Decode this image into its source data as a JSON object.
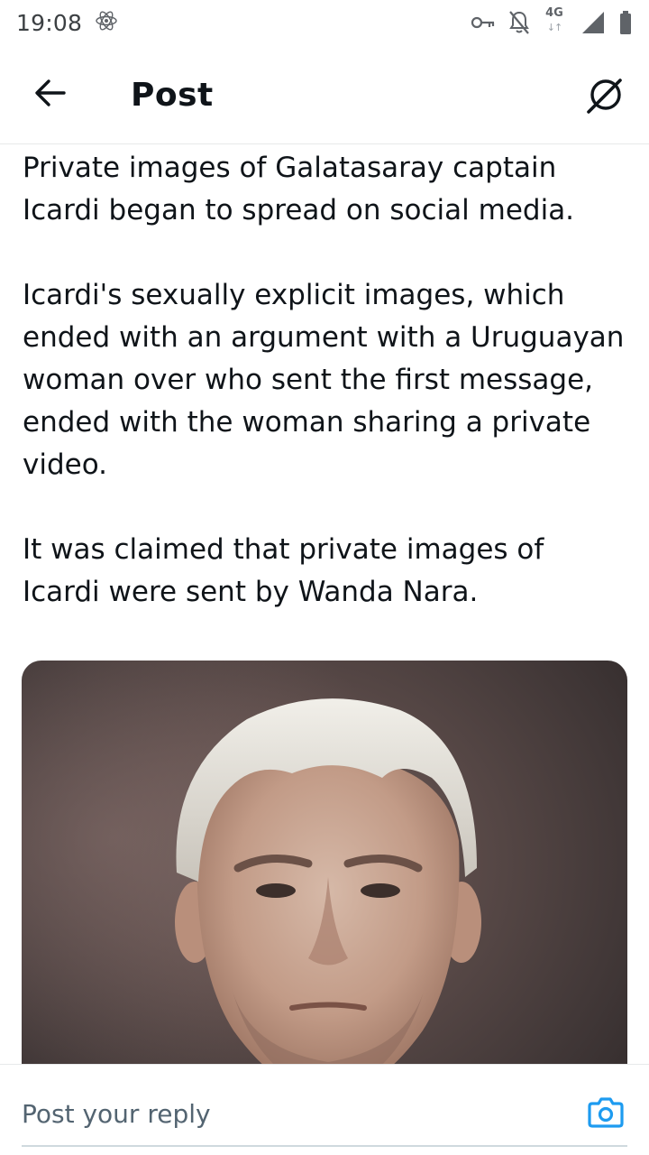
{
  "status_bar": {
    "time": "19:08",
    "icons": [
      "atom-icon",
      "vpn-key-icon",
      "notifications-off-icon",
      "network-4g-icon",
      "signal-icon",
      "battery-icon"
    ],
    "network_type": "4G",
    "network_arrows": "↓↑"
  },
  "header": {
    "back_icon": "arrow-left-icon",
    "title": "Post",
    "grok_icon": "grok-icon"
  },
  "post": {
    "paragraphs": [
      "Private images of Galatasaray captain Icardi began to spread on social media.",
      "Icardi's sexually explicit images, which ended with an argument with a Uruguayan woman over who sent the first message, ended with the woman sharing a private video.",
      "It was claimed that private images of Icardi were sent by Wanda Nara."
    ],
    "media": {
      "type": "photo",
      "subject": "portrait"
    }
  },
  "reply": {
    "placeholder": "Post your reply",
    "value": "",
    "camera_icon": "camera-icon"
  },
  "colors": {
    "text": "#0f1419",
    "secondary_text": "#536471",
    "accent": "#1d9bf0",
    "divider": "#e7e9ea"
  }
}
